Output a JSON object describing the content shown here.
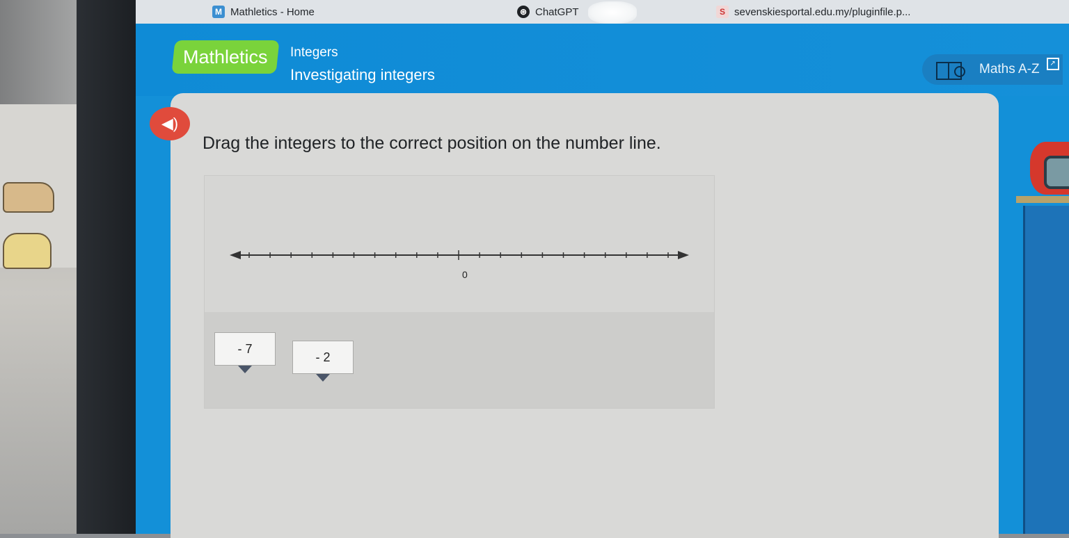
{
  "browser": {
    "tabs": [
      {
        "title": "Mathletics - Home",
        "favicon": "M"
      },
      {
        "title": "ChatGPT",
        "favicon": "⊛"
      },
      {
        "title": "sevenskiesportal.edu.my/pluginfile.p...",
        "favicon": "S"
      }
    ],
    "close_glyph": "×"
  },
  "header": {
    "logo": "Mathletics",
    "topic": "Integers",
    "activity": "Investigating integers",
    "maths_az_label": "Maths A-Z"
  },
  "activity": {
    "instruction": "Drag the integers to the correct position on the number line.",
    "number_line": {
      "min": -10,
      "max": 10,
      "labeled_tick": "0"
    },
    "tiles": [
      "- 7",
      "- 2"
    ]
  },
  "colors": {
    "header_blue": "#1390d8",
    "logo_green": "#7ad33b",
    "speaker_red": "#e04b3c",
    "card_bg": "#d9d9d7"
  },
  "icons": [
    "speaker-icon",
    "book-search-icon",
    "external-link-icon",
    "close-icon"
  ]
}
